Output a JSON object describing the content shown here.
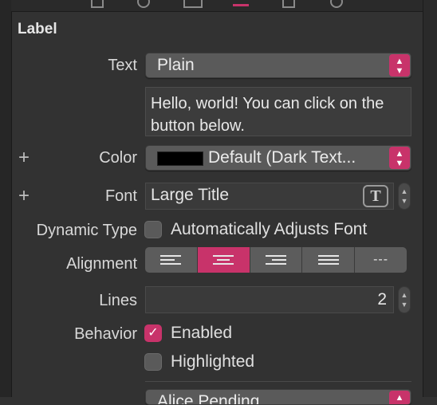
{
  "section": {
    "title": "Label"
  },
  "text": {
    "label": "Text",
    "type_value": "Plain",
    "content": "Hello, world! You can click on the button below."
  },
  "color": {
    "label": "Color",
    "value": "Default (Dark Text...",
    "swatch": "#000000"
  },
  "font": {
    "label": "Font",
    "value": "Large Title",
    "button_glyph": "T"
  },
  "dynamic_type": {
    "label": "Dynamic Type",
    "checkbox_label": "Automatically Adjusts Font",
    "checked": false
  },
  "alignment": {
    "label": "Alignment",
    "options": [
      "left",
      "center",
      "right",
      "justified",
      "natural"
    ],
    "selected": "center",
    "natural_glyph": "---"
  },
  "lines": {
    "label": "Lines",
    "value": "2"
  },
  "behavior": {
    "label": "Behavior",
    "enabled_label": "Enabled",
    "enabled_checked": true,
    "highlighted_label": "Highlighted",
    "highlighted_checked": false
  },
  "next_row": {
    "value": "Alice Pending"
  },
  "colors": {
    "accent": "#c8336a",
    "background": "#323232"
  }
}
